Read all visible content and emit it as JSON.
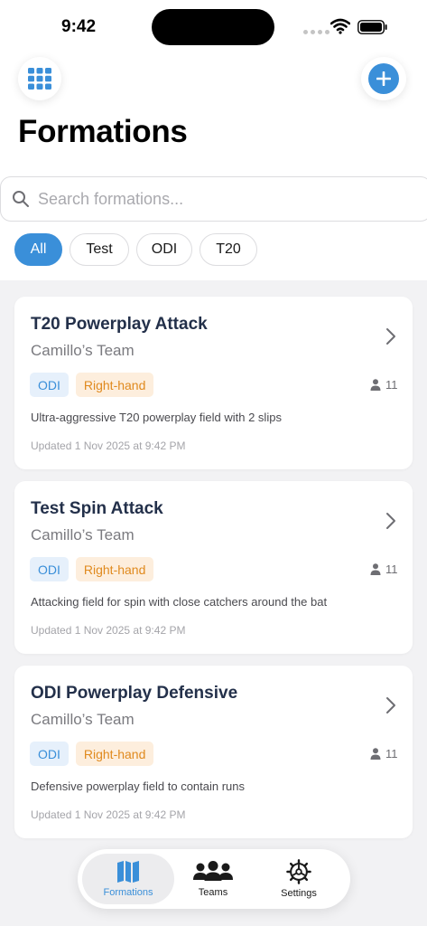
{
  "status": {
    "time": "9:42"
  },
  "header": {
    "title": "Formations"
  },
  "search": {
    "placeholder": "Search formations..."
  },
  "filters": [
    {
      "label": "All",
      "active": true
    },
    {
      "label": "Test",
      "active": false
    },
    {
      "label": "ODI",
      "active": false
    },
    {
      "label": "T20",
      "active": false
    }
  ],
  "formations": [
    {
      "title": "T20 Powerplay Attack",
      "team": "Camillo’s Team",
      "format": "ODI",
      "hand": "Right-hand",
      "players": "11",
      "description": "Ultra-aggressive T20 powerplay field with 2 slips",
      "updated": "Updated 1 Nov 2025 at 9:42 PM"
    },
    {
      "title": "Test Spin Attack",
      "team": "Camillo’s Team",
      "format": "ODI",
      "hand": "Right-hand",
      "players": "11",
      "description": "Attacking field for spin with close catchers around the bat",
      "updated": "Updated 1 Nov 2025 at 9:42 PM"
    },
    {
      "title": "ODI Powerplay Defensive",
      "team": "Camillo’s Team",
      "format": "ODI",
      "hand": "Right-hand",
      "players": "11",
      "description": "Defensive powerplay field to contain runs",
      "updated": "Updated 1 Nov 2025 at 9:42 PM"
    }
  ],
  "tabs": [
    {
      "label": "Formations",
      "icon": "map-icon",
      "active": true
    },
    {
      "label": "Teams",
      "icon": "people-icon",
      "active": false
    },
    {
      "label": "Settings",
      "icon": "gear-icon",
      "active": false
    }
  ],
  "colors": {
    "accent": "#3a8fd9",
    "title": "#23304a",
    "badge_format_bg": "#e6f0fb",
    "badge_hand_bg": "#fdeedd",
    "badge_hand_text": "#e08a1e",
    "background": "#f2f2f4"
  }
}
